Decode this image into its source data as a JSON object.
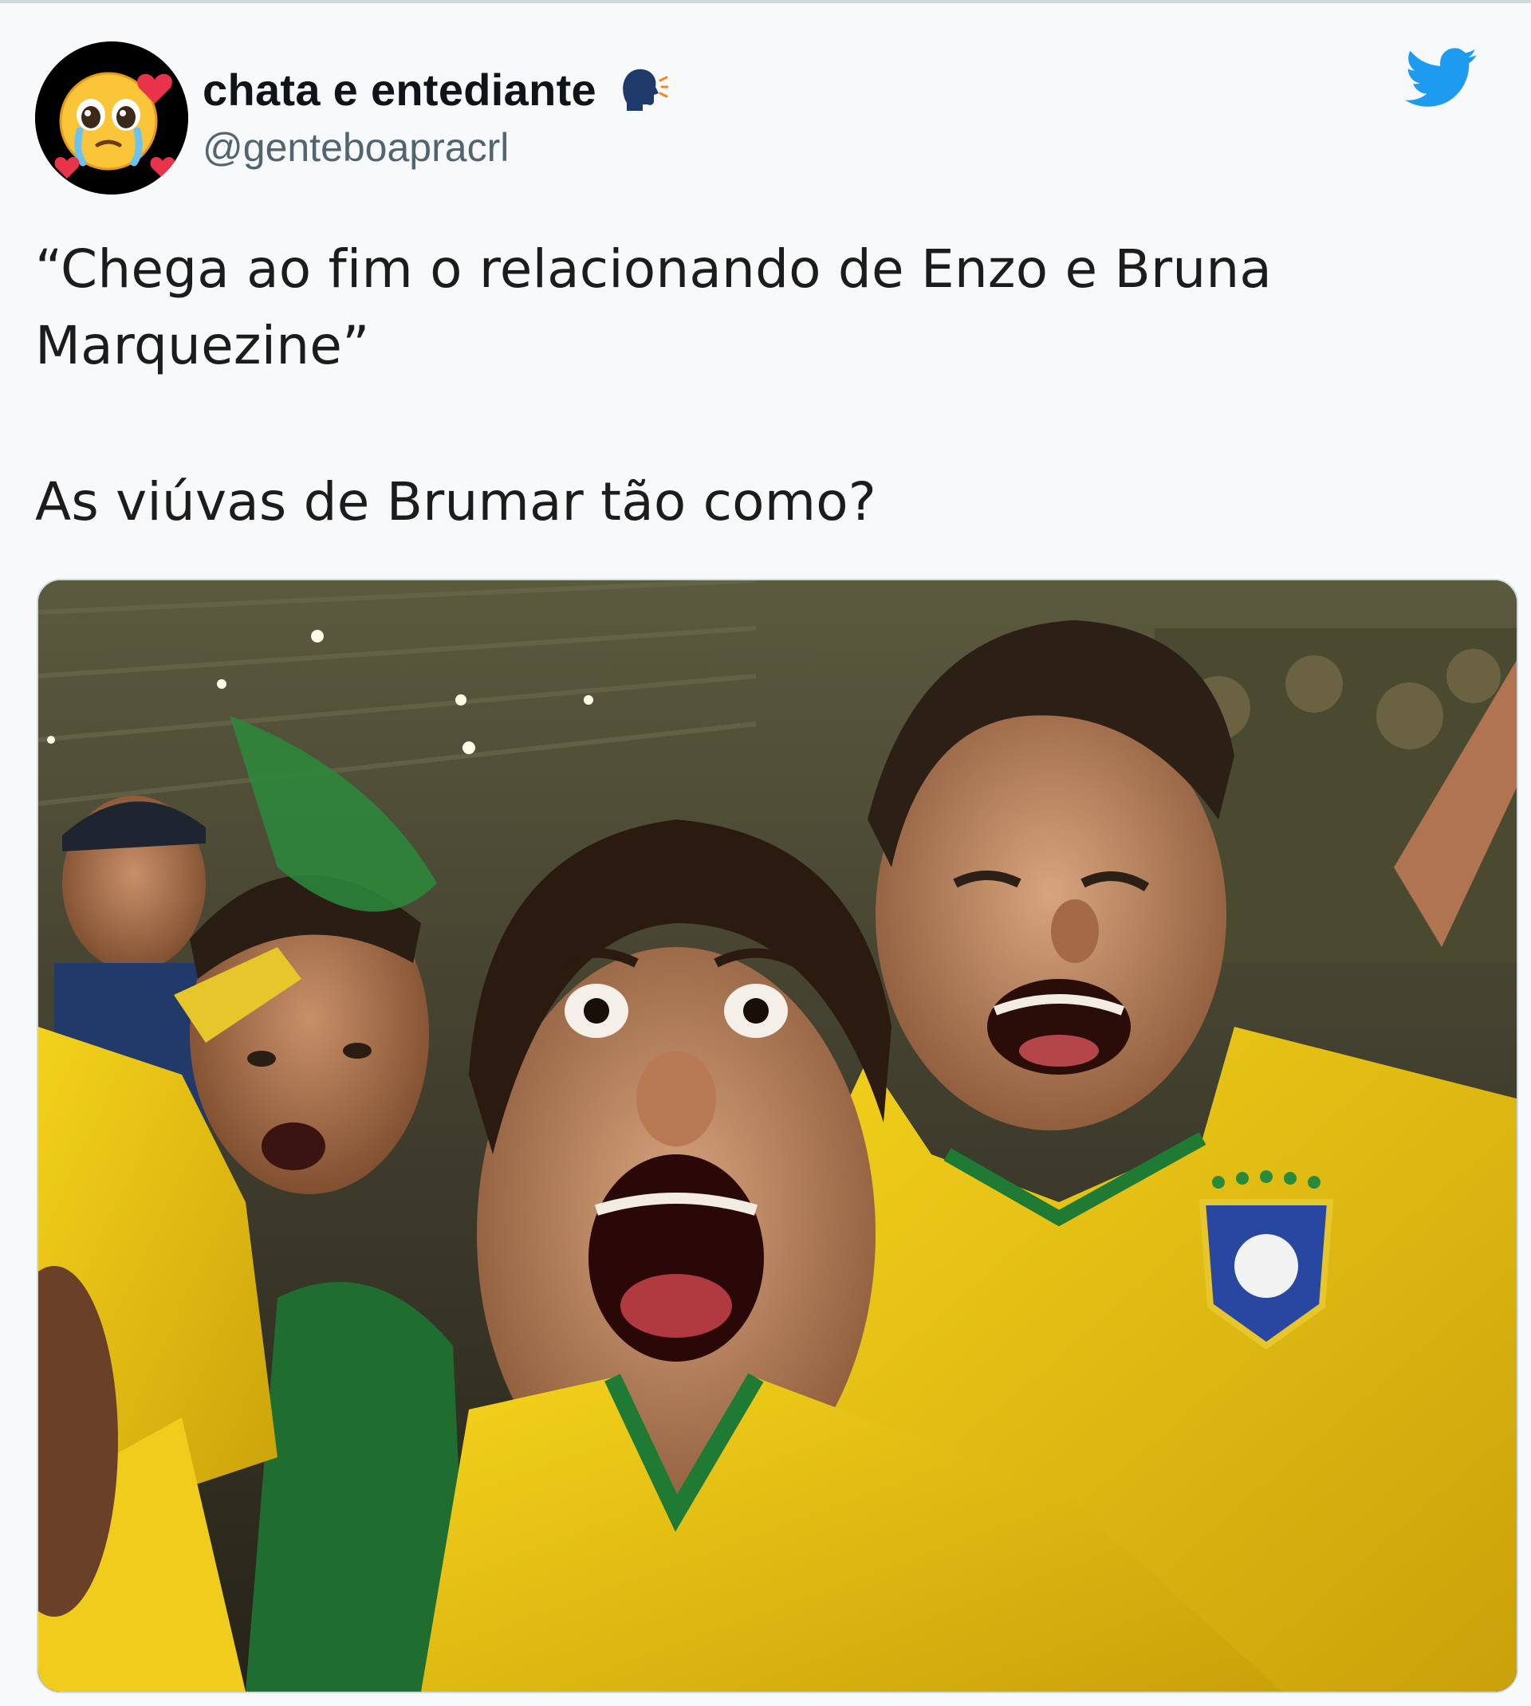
{
  "author": {
    "display_name": "chata e entediante",
    "handle": "@genteboapracrl",
    "avatar_icon": "pleading-face-with-hearts-avatar",
    "name_emoji": "speaking-head-icon"
  },
  "platform": {
    "logo_icon": "twitter-bird-icon",
    "brand_color": "#1d9bf0"
  },
  "tweet": {
    "line1": "“Chega ao fim o relacionando de Enzo e Bruna Marquezine”",
    "line2": "As viúvas de Brumar tão como?"
  },
  "media": {
    "description_icon": "photo-brazil-fans-shocked"
  }
}
